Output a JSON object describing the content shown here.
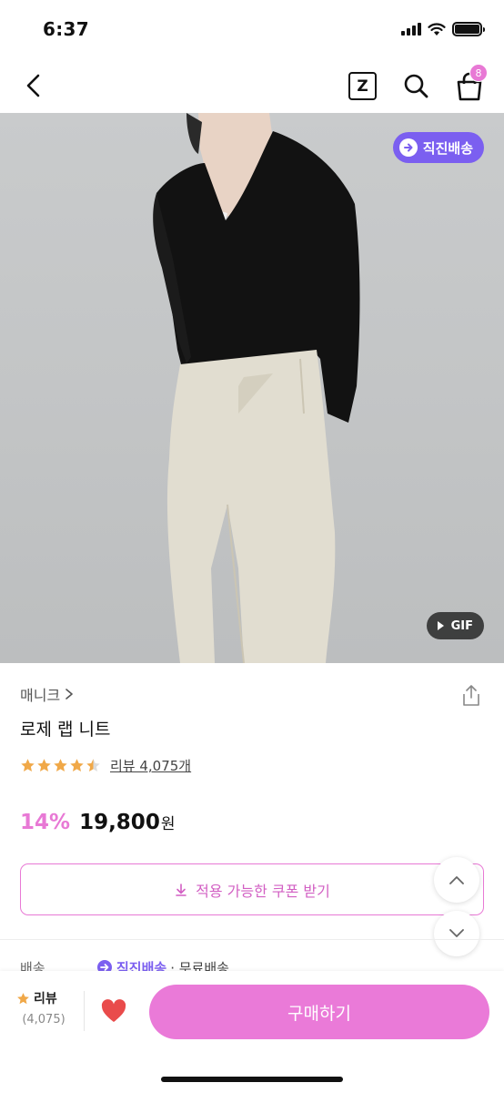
{
  "status_bar": {
    "time": "6:37"
  },
  "nav": {
    "z_label": "Z",
    "cart_count": "8"
  },
  "image": {
    "badge_direct": "직진배송",
    "badge_gif": "GIF"
  },
  "product": {
    "brand": "매니크",
    "title": "로제 랩 니트",
    "rating": 4.5,
    "review_text": "리뷰 4,075개",
    "discount": "14%",
    "price": "19,800",
    "currency": "원"
  },
  "coupon": {
    "label": "적용 가능한 쿠폰 받기"
  },
  "shipping": {
    "label": "배송",
    "direct": "직진배송",
    "free": "· 무료배송"
  },
  "bottom_bar": {
    "review_label": "리뷰",
    "review_count": "(4,075)",
    "buy_label": "구매하기"
  },
  "colors": {
    "accent_pink": "#e879d5",
    "direct_purple": "#7b5ff0",
    "star": "#f0a848",
    "heart": "#e94b4b"
  }
}
